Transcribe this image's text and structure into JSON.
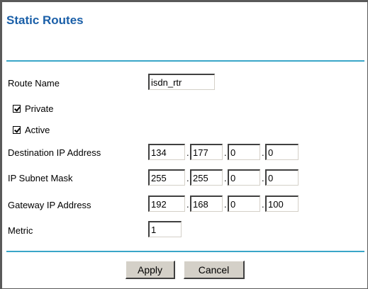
{
  "page": {
    "title": "Static Routes"
  },
  "form": {
    "route_name": {
      "label": "Route Name",
      "value": "isdn_rtr"
    },
    "private": {
      "label": "Private",
      "checked": true
    },
    "active": {
      "label": "Active",
      "checked": true
    },
    "destination_ip": {
      "label": "Destination IP Address",
      "octets": [
        "134",
        "177",
        "0",
        "0"
      ]
    },
    "subnet_mask": {
      "label": "IP Subnet Mask",
      "octets": [
        "255",
        "255",
        "0",
        "0"
      ]
    },
    "gateway_ip": {
      "label": "Gateway IP Address",
      "octets": [
        "192",
        "168",
        "0",
        "100"
      ]
    },
    "metric": {
      "label": "Metric",
      "value": "1"
    },
    "separator": "."
  },
  "buttons": {
    "apply": "Apply",
    "cancel": "Cancel"
  },
  "colors": {
    "title": "#1a5fa8",
    "divider": "#3aa6c8",
    "button_face": "#d4d0c8"
  }
}
